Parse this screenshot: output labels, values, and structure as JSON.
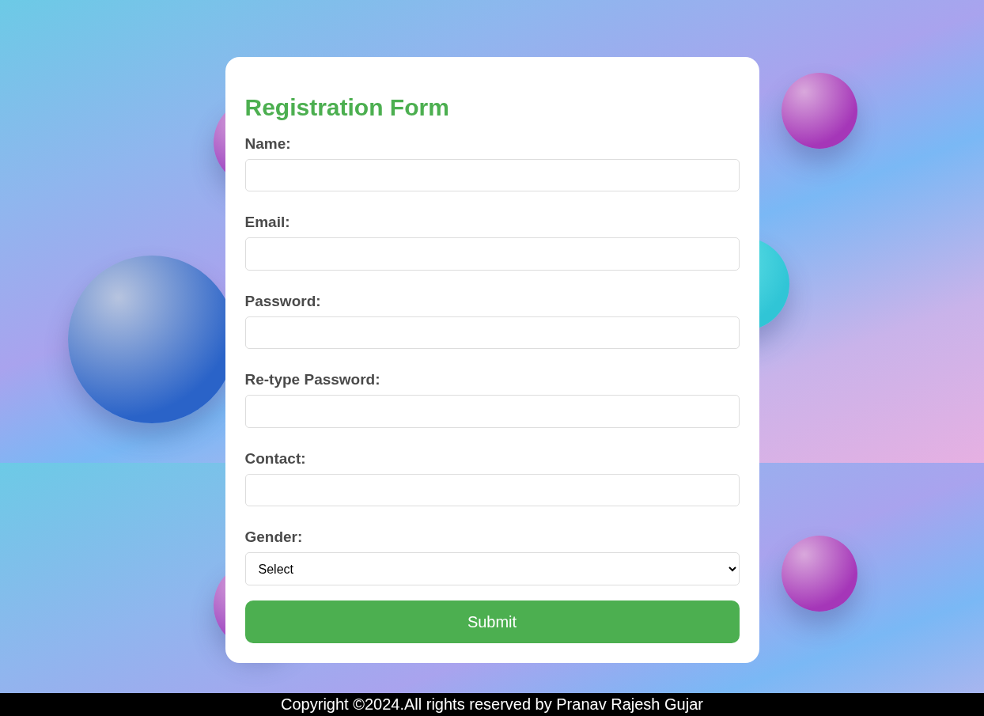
{
  "form": {
    "title": "Registration Form",
    "fields": [
      {
        "label": "Name:",
        "kind": "text"
      },
      {
        "label": "Email:",
        "kind": "text"
      },
      {
        "label": "Password:",
        "kind": "text"
      },
      {
        "label": "Re-type Password:",
        "kind": "text"
      },
      {
        "label": "Contact:",
        "kind": "text"
      },
      {
        "label": "Gender:",
        "kind": "select",
        "value": "Select"
      }
    ],
    "submit": "Submit"
  },
  "footer": {
    "text": "Copyright ©2024.All rights reserved by Pranav Rajesh Gujar"
  }
}
